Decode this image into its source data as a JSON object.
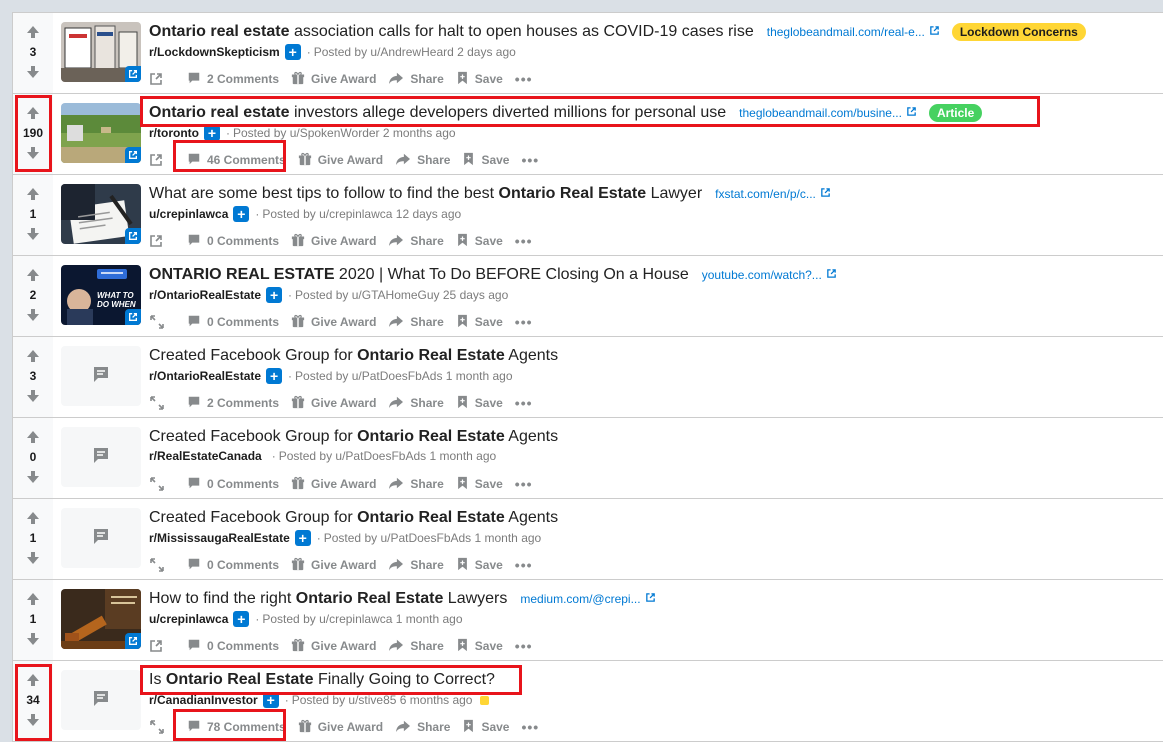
{
  "posts": [
    {
      "score": "3",
      "title_bold": "Ontario real estate",
      "title_rest": " association calls for halt to open houses as COVID-19 cases rise",
      "title_prefix": "",
      "domain": "theglobeandmail.com/real-e...",
      "flair": "Lockdown Concerns",
      "subreddit": "r/LockdownSkepticism",
      "posted": "Posted by u/AndrewHeard 2 days ago",
      "comments": "2 Comments",
      "thumb": "news-photo"
    },
    {
      "score": "190",
      "title_bold": "Ontario real estate",
      "title_rest": " investors allege developers diverted millions for personal use",
      "title_prefix": "",
      "domain": "theglobeandmail.com/busine...",
      "flair": "Article",
      "subreddit": "r/toronto",
      "posted": "Posted by u/SpokenWorder 2 months ago",
      "comments": "46 Comments",
      "thumb": "field-photo"
    },
    {
      "score": "1",
      "title_prefix": "What are some best tips to follow to find the best ",
      "title_bold": "Ontario Real Estate",
      "title_rest": " Lawyer",
      "domain": "fxstat.com/en/p/c...",
      "flair": "",
      "subreddit": "u/crepinlawca",
      "posted": "Posted by u/crepinlawca 12 days ago",
      "comments": "0 Comments",
      "thumb": "document-photo"
    },
    {
      "score": "2",
      "title_prefix": "",
      "title_bold": "ONTARIO REAL ESTATE",
      "title_rest": " 2020 | What To Do BEFORE Closing On a House",
      "domain": "youtube.com/watch?...",
      "flair": "",
      "subreddit": "r/OntarioRealEstate",
      "posted": "Posted by u/GTAHomeGuy 25 days ago",
      "comments": "0 Comments",
      "thumb": "video-thumbnail",
      "thumb_text": "WHAT TO DO WHEN"
    },
    {
      "score": "3",
      "title_prefix": "Created Facebook Group for ",
      "title_bold": "Ontario Real Estate",
      "title_rest": " Agents",
      "domain": "",
      "flair": "",
      "subreddit": "r/OntarioRealEstate",
      "posted": "Posted by u/PatDoesFbAds 1 month ago",
      "comments": "2 Comments",
      "thumb": "text"
    },
    {
      "score": "0",
      "title_prefix": "Created Facebook Group for ",
      "title_bold": "Ontario Real Estate",
      "title_rest": " Agents",
      "domain": "",
      "flair": "",
      "subreddit": "r/RealEstateCanada",
      "posted": "Posted by u/PatDoesFbAds 1 month ago",
      "comments": "0 Comments",
      "thumb": "text"
    },
    {
      "score": "1",
      "title_prefix": "Created Facebook Group for ",
      "title_bold": "Ontario Real Estate",
      "title_rest": " Agents",
      "domain": "",
      "flair": "",
      "subreddit": "r/MississaugaRealEstate",
      "posted": "Posted by u/PatDoesFbAds 1 month ago",
      "comments": "0 Comments",
      "thumb": "text"
    },
    {
      "score": "1",
      "title_prefix": "How to find the right ",
      "title_bold": "Ontario Real Estate",
      "title_rest": " Lawyers",
      "domain": "medium.com/@crepi...",
      "flair": "",
      "subreddit": "u/crepinlawca",
      "posted": "Posted by u/crepinlawca 1 month ago",
      "comments": "0 Comments",
      "thumb": "gavel-photo"
    },
    {
      "score": "34",
      "title_prefix": "Is ",
      "title_bold": "Ontario Real Estate",
      "title_rest": " Finally Going to Correct?",
      "domain": "",
      "flair": "",
      "subreddit": "r/CanadianInvestor",
      "posted": "Posted by u/stive85 6 months ago",
      "comments": "78 Comments",
      "thumb": "text"
    }
  ],
  "actions": {
    "give_award": "Give Award",
    "share": "Share",
    "save": "Save",
    "more": "•••"
  },
  "colors": {
    "lockdown_flair_bg": "#ffd635",
    "article_flair_bg": "#46d160",
    "link_blue": "#0079d3",
    "highlight_red": "#e8141b"
  }
}
